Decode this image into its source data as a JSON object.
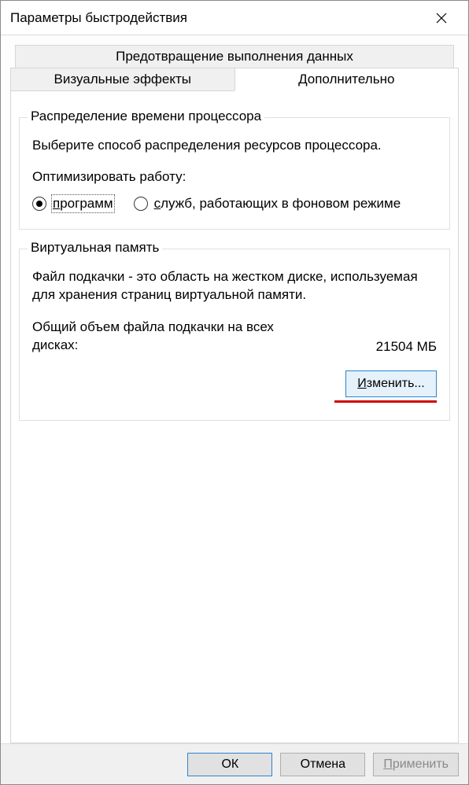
{
  "window": {
    "title": "Параметры быстродействия"
  },
  "tabs": {
    "dep": "Предотвращение выполнения данных",
    "visual": "Визуальные эффекты",
    "advanced": "Дополнительно"
  },
  "cpu_group": {
    "legend": "Распределение времени процессора",
    "desc": "Выберите способ распределения ресурсов процессора.",
    "optimize_label": "Оптимизировать работу:",
    "radio_programs": "программ",
    "radio_services": "служб, работающих в фоновом режиме"
  },
  "vm_group": {
    "legend": "Виртуальная память",
    "desc": "Файл подкачки - это область на жестком диске, используемая для хранения страниц виртуальной памяти.",
    "total_label": "Общий объем файла подкачки на всех дисках:",
    "total_value": "21504 МБ",
    "change_btn": "Изменить..."
  },
  "buttons": {
    "ok": "ОК",
    "cancel": "Отмена",
    "apply": "Применить"
  }
}
